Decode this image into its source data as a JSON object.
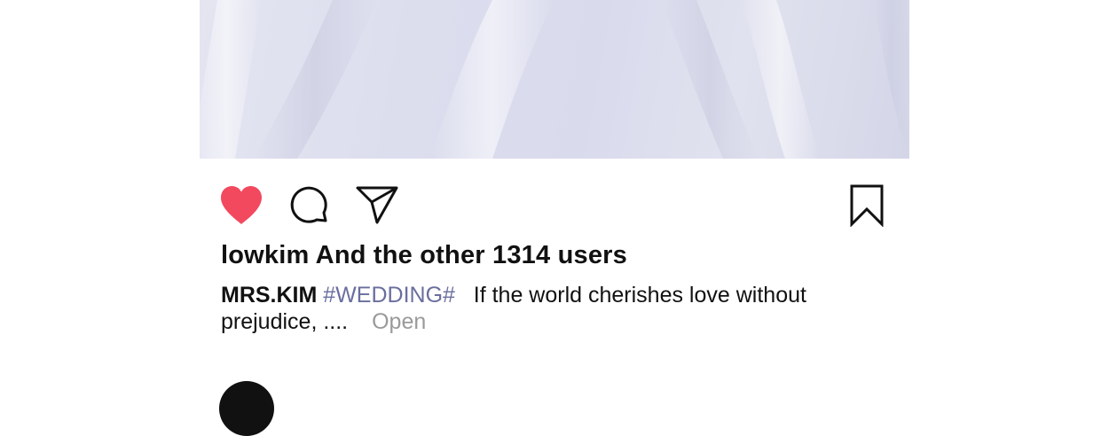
{
  "post": {
    "photo_alt": "Wedding dress fabric close-up",
    "actions": {
      "like_icon": "heart-filled-icon",
      "comment_icon": "comment-bubble-icon",
      "share_icon": "paper-plane-icon",
      "save_icon": "bookmark-icon",
      "like_color": "#f2495e"
    },
    "likes_text": "lowkim And the other 1314 users",
    "caption": {
      "author": "MRS.KIM",
      "hashtag": "#WEDDING#",
      "text": "If the world cherishes love without prejudice, ....",
      "more_label": "Open"
    }
  }
}
